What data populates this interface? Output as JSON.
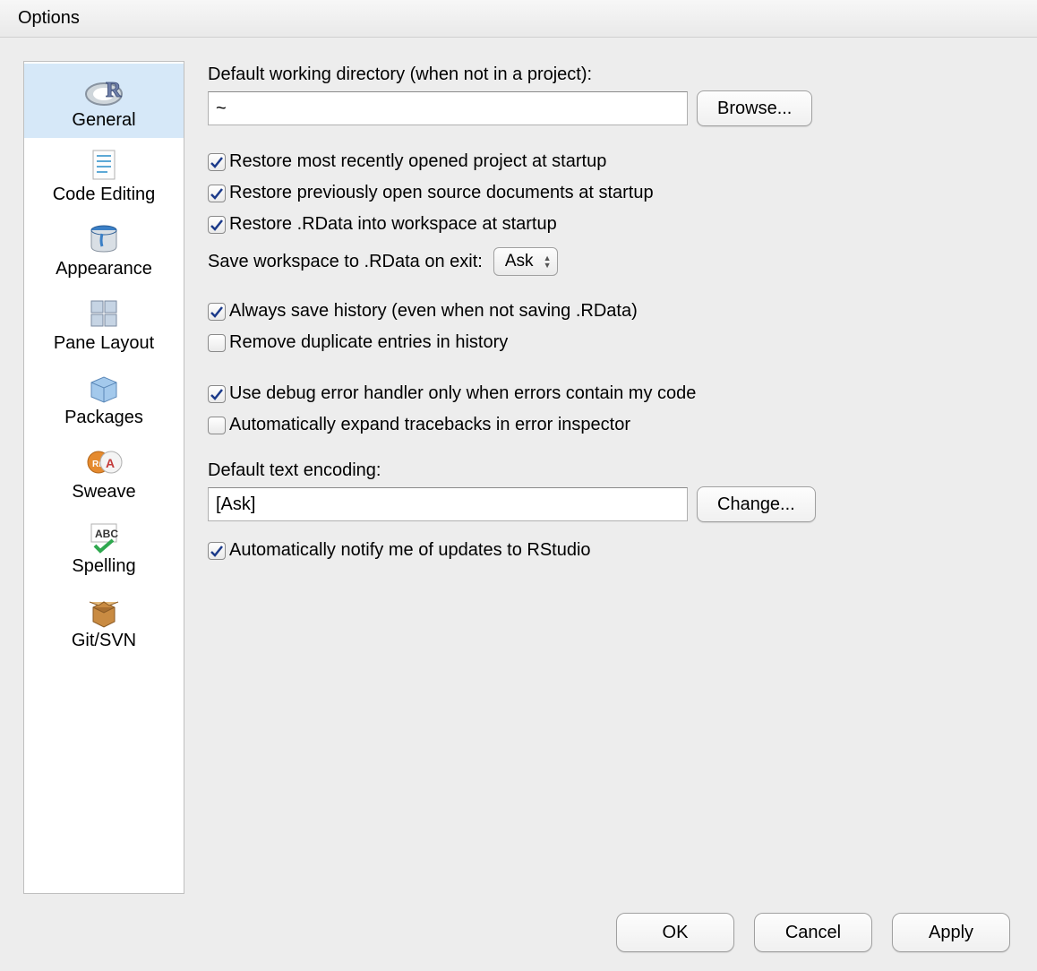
{
  "window": {
    "title": "Options"
  },
  "sidebar": {
    "items": [
      {
        "label": "General"
      },
      {
        "label": "Code Editing"
      },
      {
        "label": "Appearance"
      },
      {
        "label": "Pane Layout"
      },
      {
        "label": "Packages"
      },
      {
        "label": "Sweave"
      },
      {
        "label": "Spelling"
      },
      {
        "label": "Git/SVN"
      }
    ]
  },
  "main": {
    "workdir": {
      "label": "Default working directory (when not in a project):",
      "value": "~",
      "browse": "Browse..."
    },
    "checks": {
      "restore_project": "Restore most recently opened project at startup",
      "restore_docs": "Restore previously open source documents at startup",
      "restore_rdata": "Restore .RData into workspace at startup",
      "save_workspace_label": "Save workspace to .RData on exit:",
      "save_workspace_value": "Ask",
      "always_save_history": "Always save history (even when not saving .RData)",
      "remove_dup_history": "Remove duplicate entries in history",
      "debug_handler": "Use debug error handler only when errors contain my code",
      "auto_expand_traceback": "Automatically expand tracebacks in error inspector",
      "notify_updates": "Automatically notify me of updates to RStudio"
    },
    "encoding": {
      "label": "Default text encoding:",
      "value": "[Ask]",
      "change": "Change..."
    }
  },
  "footer": {
    "ok": "OK",
    "cancel": "Cancel",
    "apply": "Apply"
  }
}
